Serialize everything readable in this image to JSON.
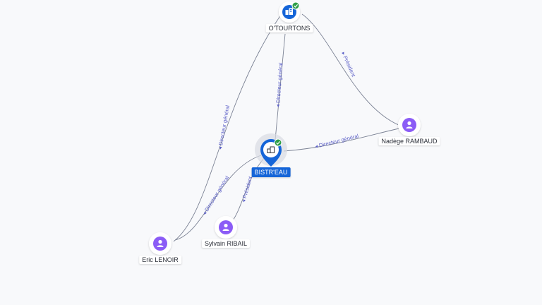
{
  "colors": {
    "company": "#1565d8",
    "person": "#8b5cf6",
    "verified": "#2e9e47",
    "edge": "#7b8294",
    "edge_label": "#5b5fc7"
  },
  "nodes": {
    "otourtons": {
      "label": "O'TOURTONS",
      "icon": "building-icon",
      "verified": true
    },
    "bistreau": {
      "label": "BISTR'EAU",
      "icon": "building-icon",
      "verified": true
    },
    "nadege": {
      "label": "Nadège RAMBAUD",
      "icon": "person-icon"
    },
    "sylvain": {
      "label": "Sylvain RIBAIL",
      "icon": "person-icon"
    },
    "eric": {
      "label": "Eric LENOIR",
      "icon": "person-icon"
    }
  },
  "edges": {
    "eric_otourtons": {
      "label": "Directeur général"
    },
    "nadege_otourtons": {
      "label": "Président"
    },
    "bistreau_otourtons": {
      "label": "Directeur général"
    },
    "nadege_bistreau": {
      "label": "Directeur général"
    },
    "eric_bistreau": {
      "label": "Directeur général"
    },
    "sylvain_bistreau": {
      "label": "Président"
    }
  }
}
